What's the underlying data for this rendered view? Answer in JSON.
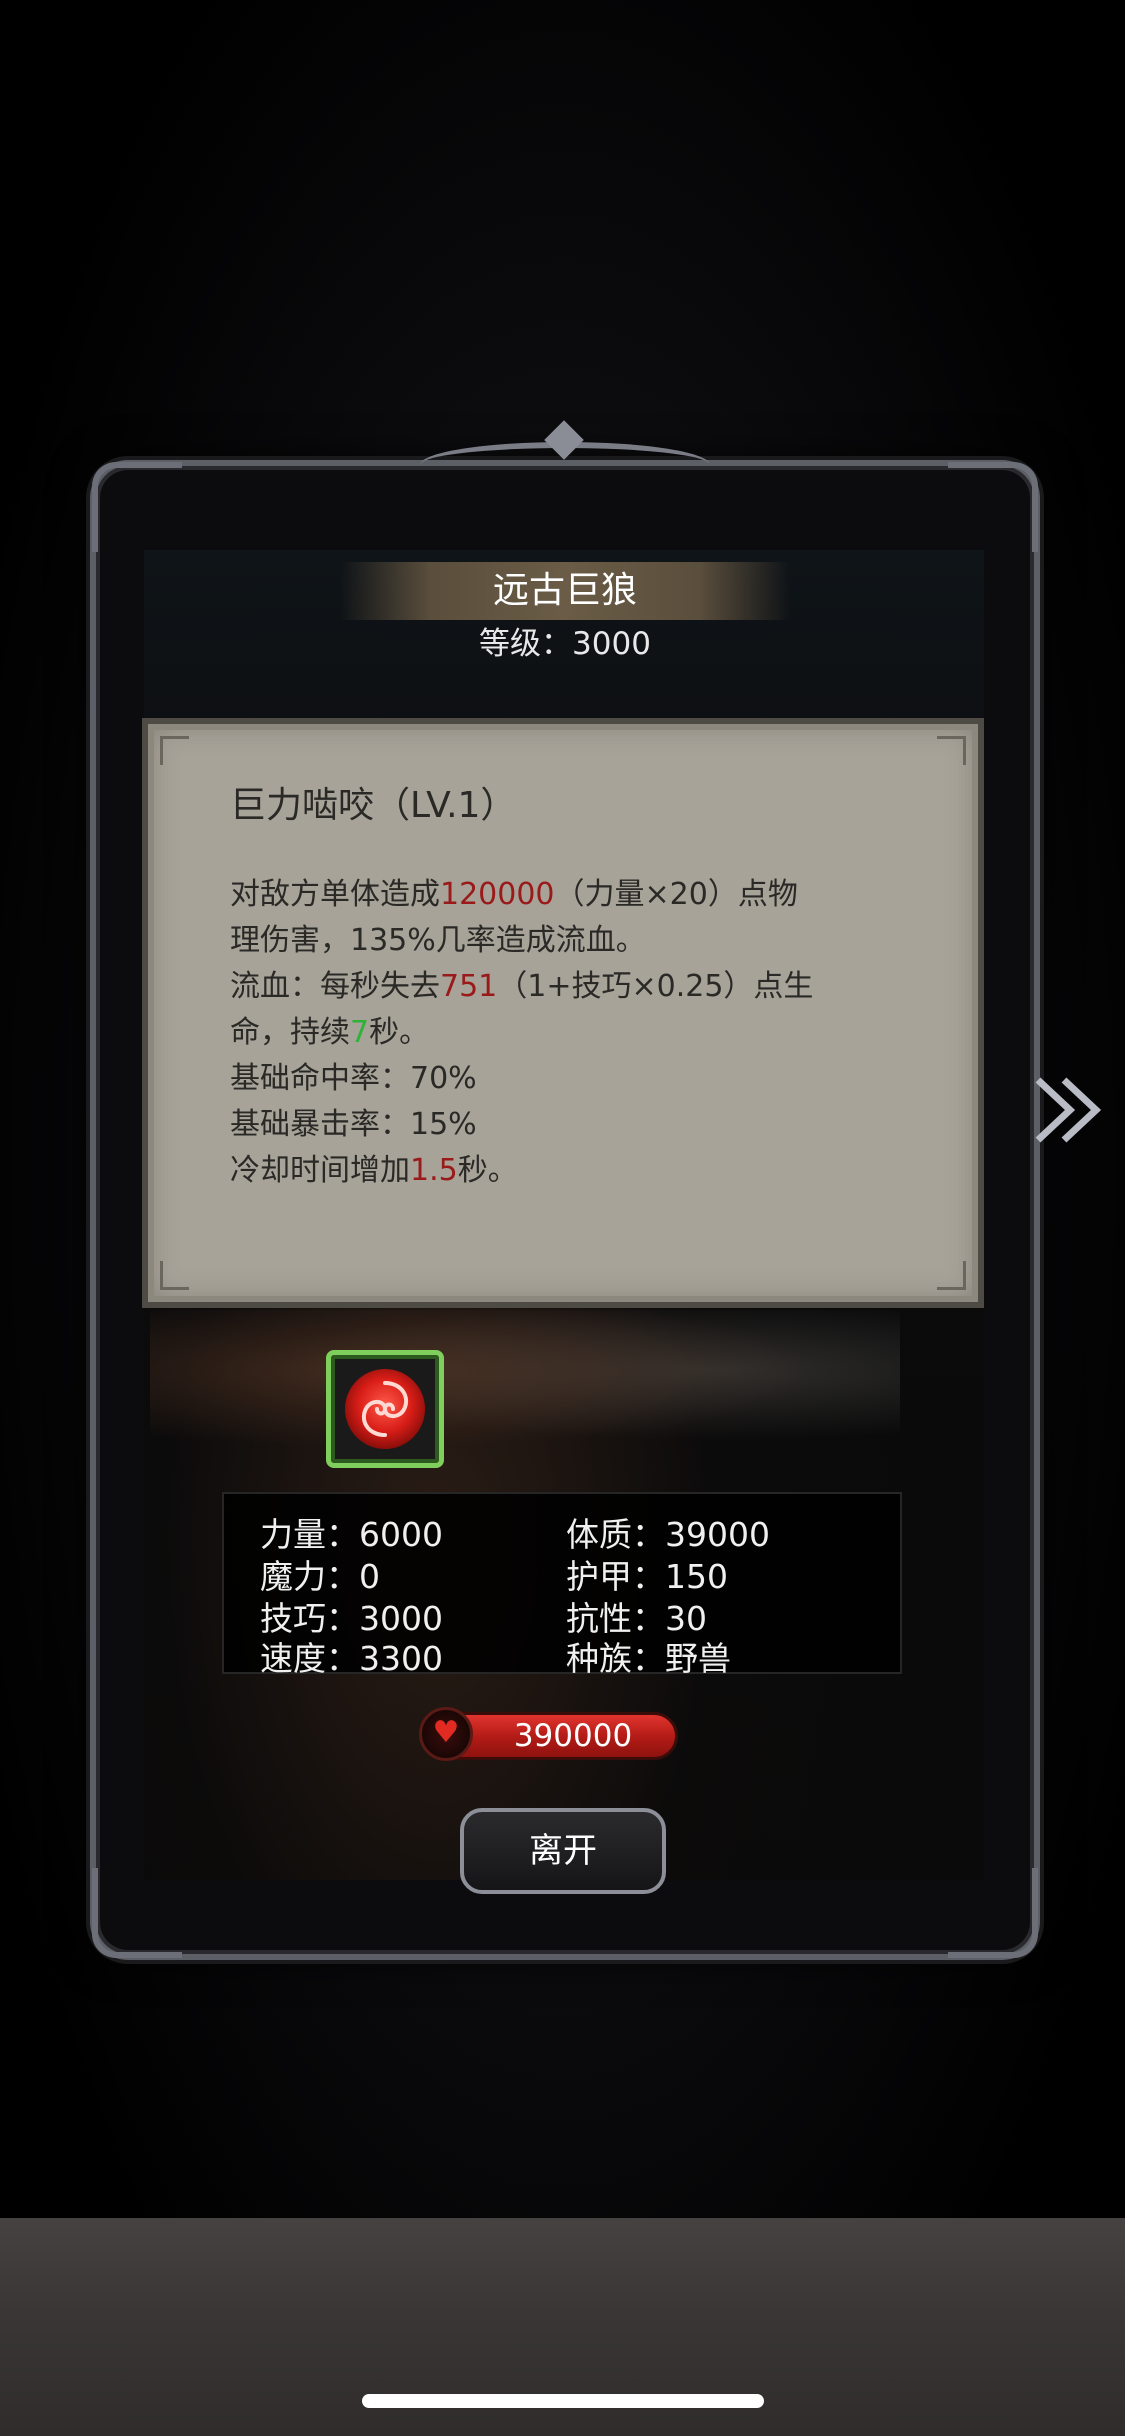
{
  "monster": {
    "name": "远古巨狼",
    "level": "等级：3000"
  },
  "skill": {
    "title": "巨力啮咬（LV.1）",
    "lines": [
      {
        "a": "对敌方单体造成",
        "b": "120000",
        "c": "（力量×20）点物"
      },
      {
        "a": "理伤害，135%几率造成流血。"
      },
      {
        "a": "流血：每秒失去",
        "b": "751",
        "c": "（1+技巧×0.25）点生"
      },
      {
        "a": "命，持续",
        "g": "7",
        "c": "秒。"
      },
      {
        "a": "基础命中率：70%"
      },
      {
        "a": "基础暴击率：15%"
      },
      {
        "a": "冷却时间增加",
        "b": "1.5",
        "c": "秒。"
      }
    ]
  },
  "stats": {
    "strength": "力量：6000",
    "constitution": "体质：39000",
    "magic": "魔力：0",
    "armor": "护甲：150",
    "skill": "技巧：3000",
    "resistance": "抗性：30",
    "speed": "速度：3300",
    "race": "种族：野兽"
  },
  "hp": {
    "value": "390000",
    "icon": "heart-icon"
  },
  "buttons": {
    "leave": "离开"
  },
  "icons": {
    "next": "double-chevron-right-icon",
    "skill": "red-swirl-skill-icon"
  },
  "colors": {
    "damage": "#9a1a1a",
    "duration": "#2fb238",
    "hp_bar": "#c4221c",
    "skill_frame": "#7fcf5c"
  }
}
